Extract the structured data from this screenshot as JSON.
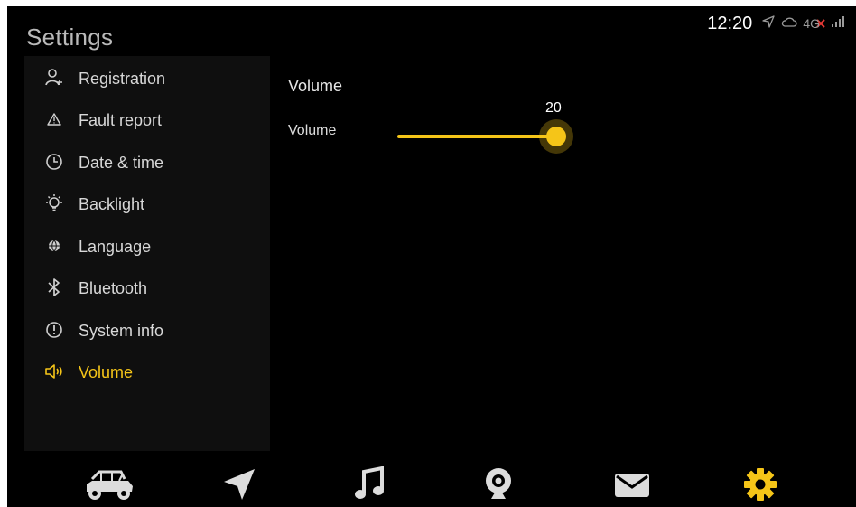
{
  "title": "Settings",
  "status": {
    "time": "12:20",
    "network": "4G"
  },
  "sidebar": {
    "items": [
      {
        "label": "Registration",
        "icon": "person-add-icon"
      },
      {
        "label": "Fault report",
        "icon": "warning-icon"
      },
      {
        "label": "Date & time",
        "icon": "clock-icon"
      },
      {
        "label": "Backlight",
        "icon": "lightbulb-icon"
      },
      {
        "label": "Language",
        "icon": "globe-icon"
      },
      {
        "label": "Bluetooth",
        "icon": "bluetooth-icon"
      },
      {
        "label": "System info",
        "icon": "info-icon"
      },
      {
        "label": "Volume",
        "icon": "speaker-icon"
      }
    ],
    "active_index": 7
  },
  "main": {
    "heading": "Volume",
    "volume": {
      "label": "Volume",
      "value": "20"
    }
  },
  "bottom_nav": [
    "vehicle-icon",
    "navigation-icon",
    "music-icon",
    "camera-icon",
    "mail-icon",
    "settings-gear-icon"
  ],
  "colors": {
    "accent": "#f5c518",
    "background": "#000000",
    "sidebar": "#0f0f0f"
  }
}
